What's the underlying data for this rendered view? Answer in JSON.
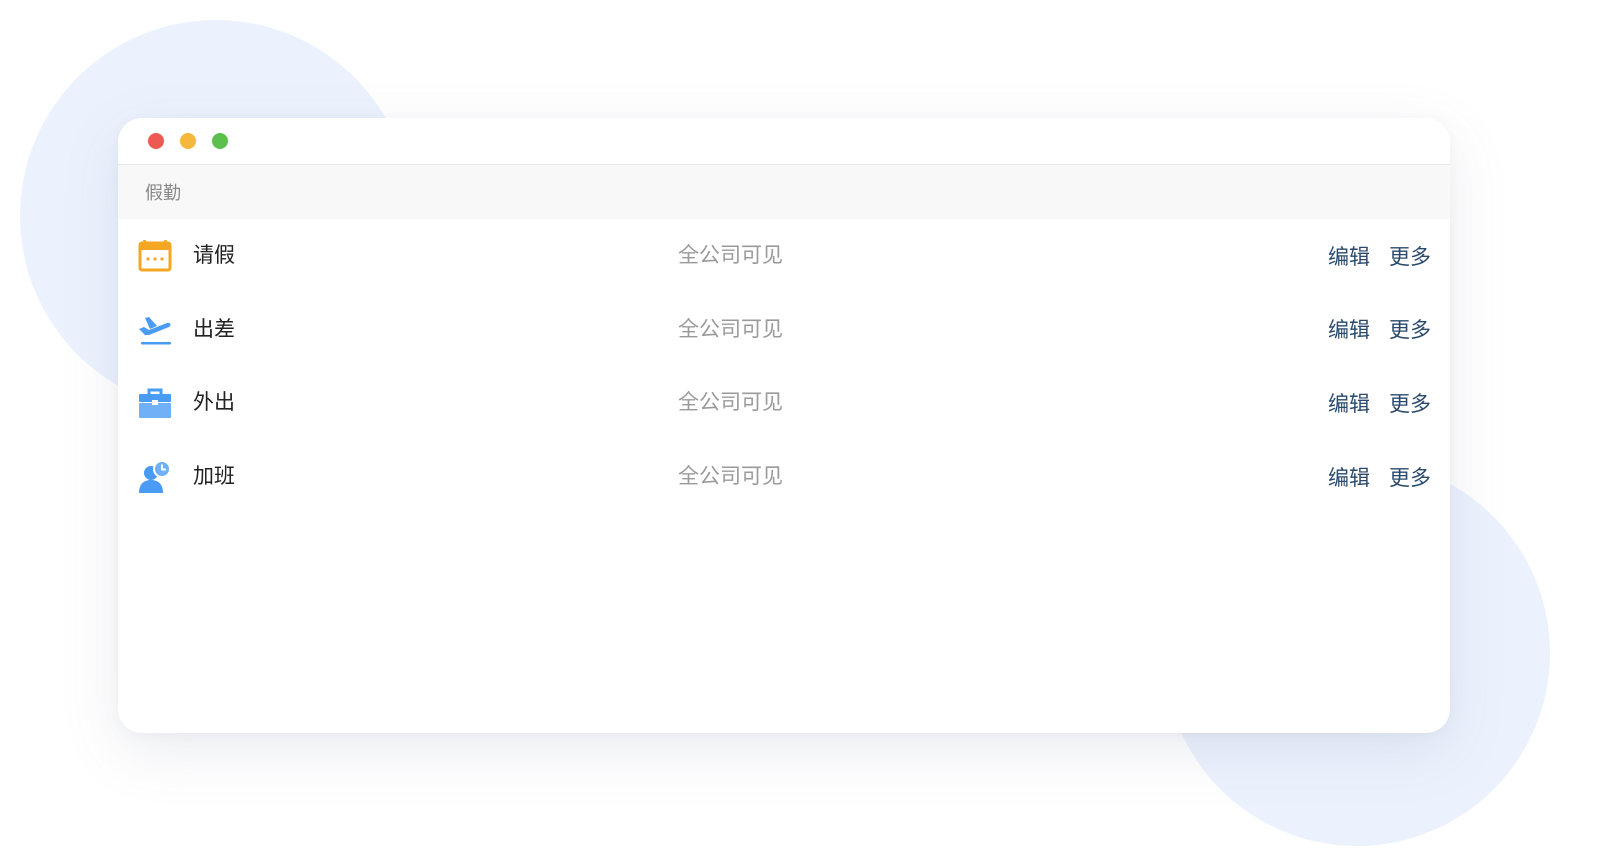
{
  "window": {
    "controls": {
      "close_color": "#ee5a52",
      "minimize_color": "#f5b83c",
      "maximize_color": "#5cc04c"
    }
  },
  "section": {
    "title": "假勤"
  },
  "rows": [
    {
      "name": "请假",
      "visibility": "全公司可见",
      "edit_label": "编辑",
      "more_label": "更多",
      "icon": "calendar-icon",
      "icon_color": "#f5a623"
    },
    {
      "name": "出差",
      "visibility": "全公司可见",
      "edit_label": "编辑",
      "more_label": "更多",
      "icon": "airplane-icon",
      "icon_color": "#4a9bf3"
    },
    {
      "name": "外出",
      "visibility": "全公司可见",
      "edit_label": "编辑",
      "more_label": "更多",
      "icon": "briefcase-icon",
      "icon_color": "#4a9bf3"
    },
    {
      "name": "加班",
      "visibility": "全公司可见",
      "edit_label": "编辑",
      "more_label": "更多",
      "icon": "user-clock-icon",
      "icon_color": "#4a9bf3"
    }
  ],
  "colors": {
    "background_blob": "#ecf2fd",
    "action_link": "#2a4a6d",
    "muted_text": "#9a9a9a"
  }
}
